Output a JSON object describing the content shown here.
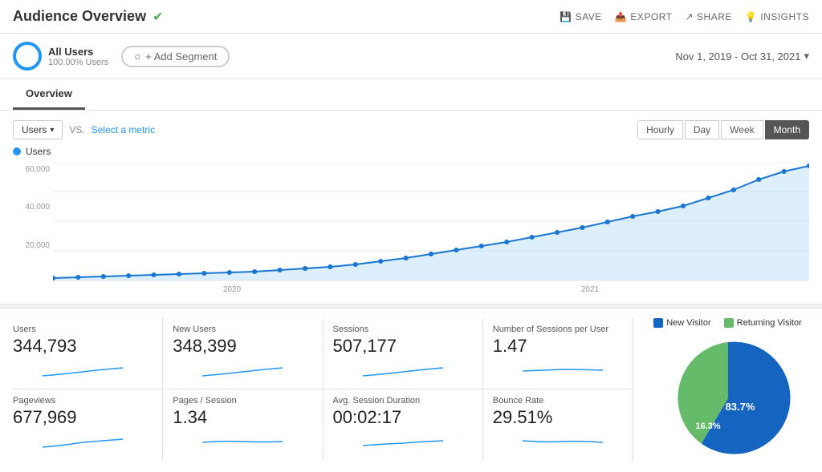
{
  "header": {
    "title": "Audience Overview",
    "actions": [
      {
        "label": "SAVE",
        "icon": "💾"
      },
      {
        "label": "EXPORT",
        "icon": "📤"
      },
      {
        "label": "SHARE",
        "icon": "↗"
      },
      {
        "label": "INSIGHTS",
        "icon": "💡"
      }
    ]
  },
  "segment": {
    "name": "All Users",
    "pct": "100.00% Users",
    "add_label": "+ Add Segment",
    "date_range": "Nov 1, 2019 - Oct 31, 2021"
  },
  "tabs": [
    {
      "label": "Overview",
      "active": true
    }
  ],
  "chart": {
    "metric_label": "Users",
    "vs": "VS.",
    "select_metric": "Select a metric",
    "time_buttons": [
      "Hourly",
      "Day",
      "Week",
      "Month"
    ],
    "active_time": "Month",
    "y_labels": [
      "60,000",
      "40,000",
      "20,000",
      ""
    ],
    "x_labels": [
      "2020",
      "2021"
    ],
    "legend": "Users"
  },
  "metrics": [
    {
      "label": "Users",
      "value": "344,793"
    },
    {
      "label": "New Users",
      "value": "348,399"
    },
    {
      "label": "Sessions",
      "value": "507,177"
    },
    {
      "label": "Number of Sessions per User",
      "value": "1.47"
    },
    {
      "label": "Pageviews",
      "value": "677,969"
    },
    {
      "label": "Pages / Session",
      "value": "1.34"
    },
    {
      "label": "Avg. Session Duration",
      "value": "00:02:17"
    },
    {
      "label": "Bounce Rate",
      "value": "29.51%"
    }
  ],
  "pie": {
    "new_visitor_label": "New Visitor",
    "returning_visitor_label": "Returning Visitor",
    "new_pct": "83.7",
    "returning_pct": "16.3"
  }
}
